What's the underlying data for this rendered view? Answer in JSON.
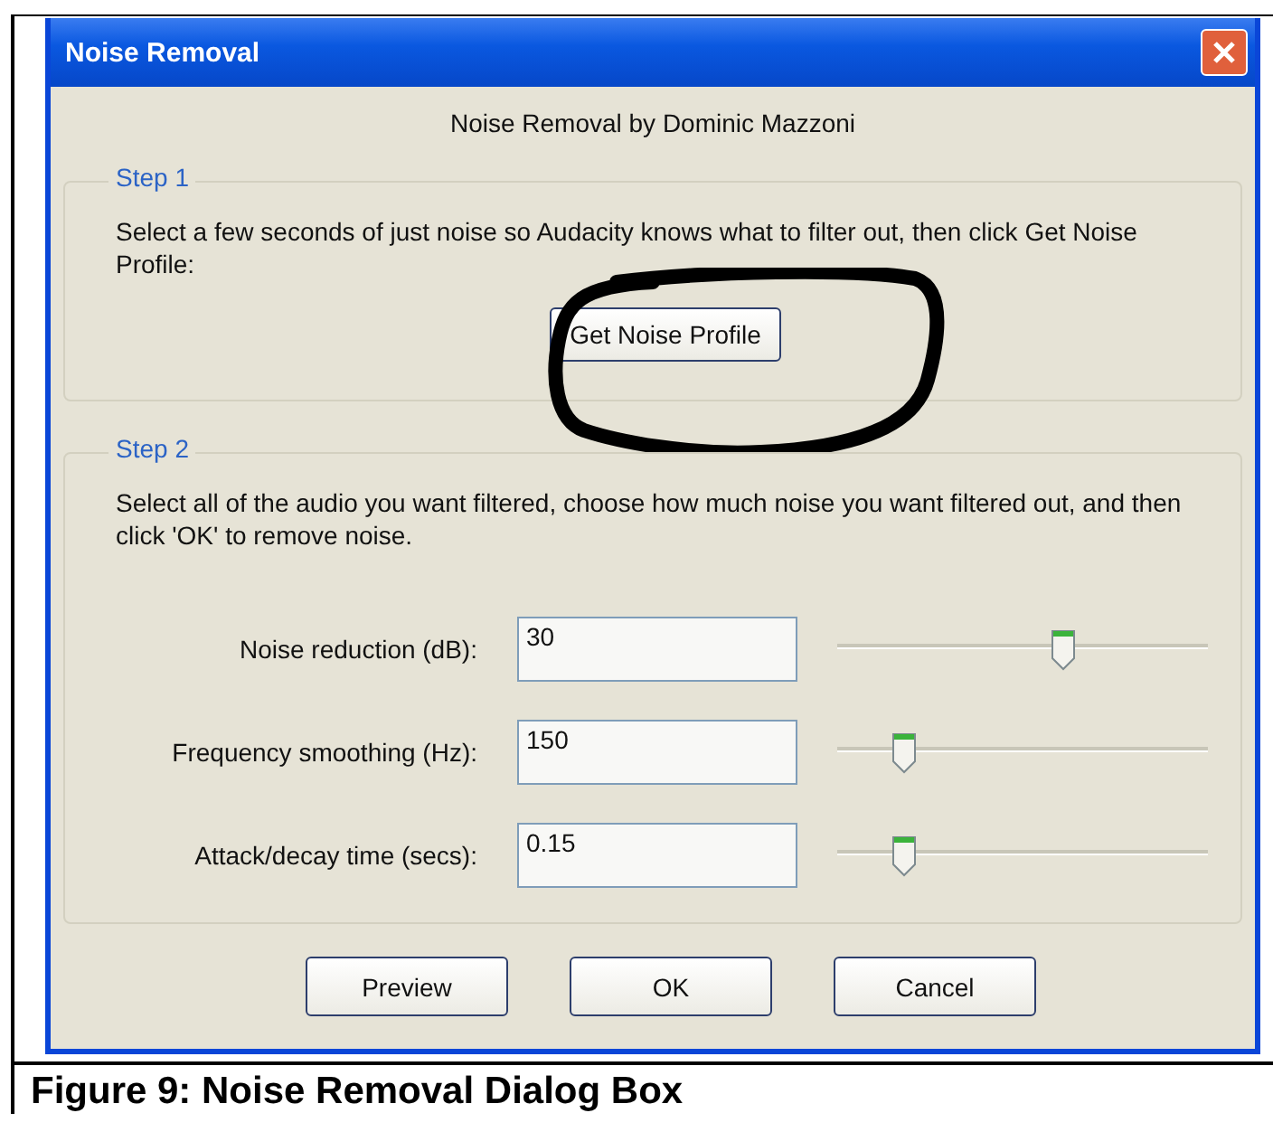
{
  "dialog": {
    "title": "Noise Removal",
    "subtitle": "Noise Removal by Dominic Mazzoni",
    "step1": {
      "legend": "Step 1",
      "text": "Select a few seconds of just noise so Audacity knows what to filter out, then click Get Noise Profile:",
      "button": "Get Noise Profile",
      "circled": true
    },
    "step2": {
      "legend": "Step 2",
      "text": "Select all of the audio you want filtered, choose how much noise you want filtered out, and then click 'OK' to remove noise.",
      "settings": [
        {
          "label": "Noise reduction (dB):",
          "value": "30",
          "level": 0.61
        },
        {
          "label": "Frequency smoothing (Hz):",
          "value": "150",
          "level": 0.18
        },
        {
          "label": "Attack/decay time (secs):",
          "value": "0.15",
          "level": 0.18
        }
      ]
    },
    "buttons": [
      "Preview",
      "OK",
      "Cancel"
    ]
  },
  "caption": "Figure 9: Noise Removal Dialog Box"
}
